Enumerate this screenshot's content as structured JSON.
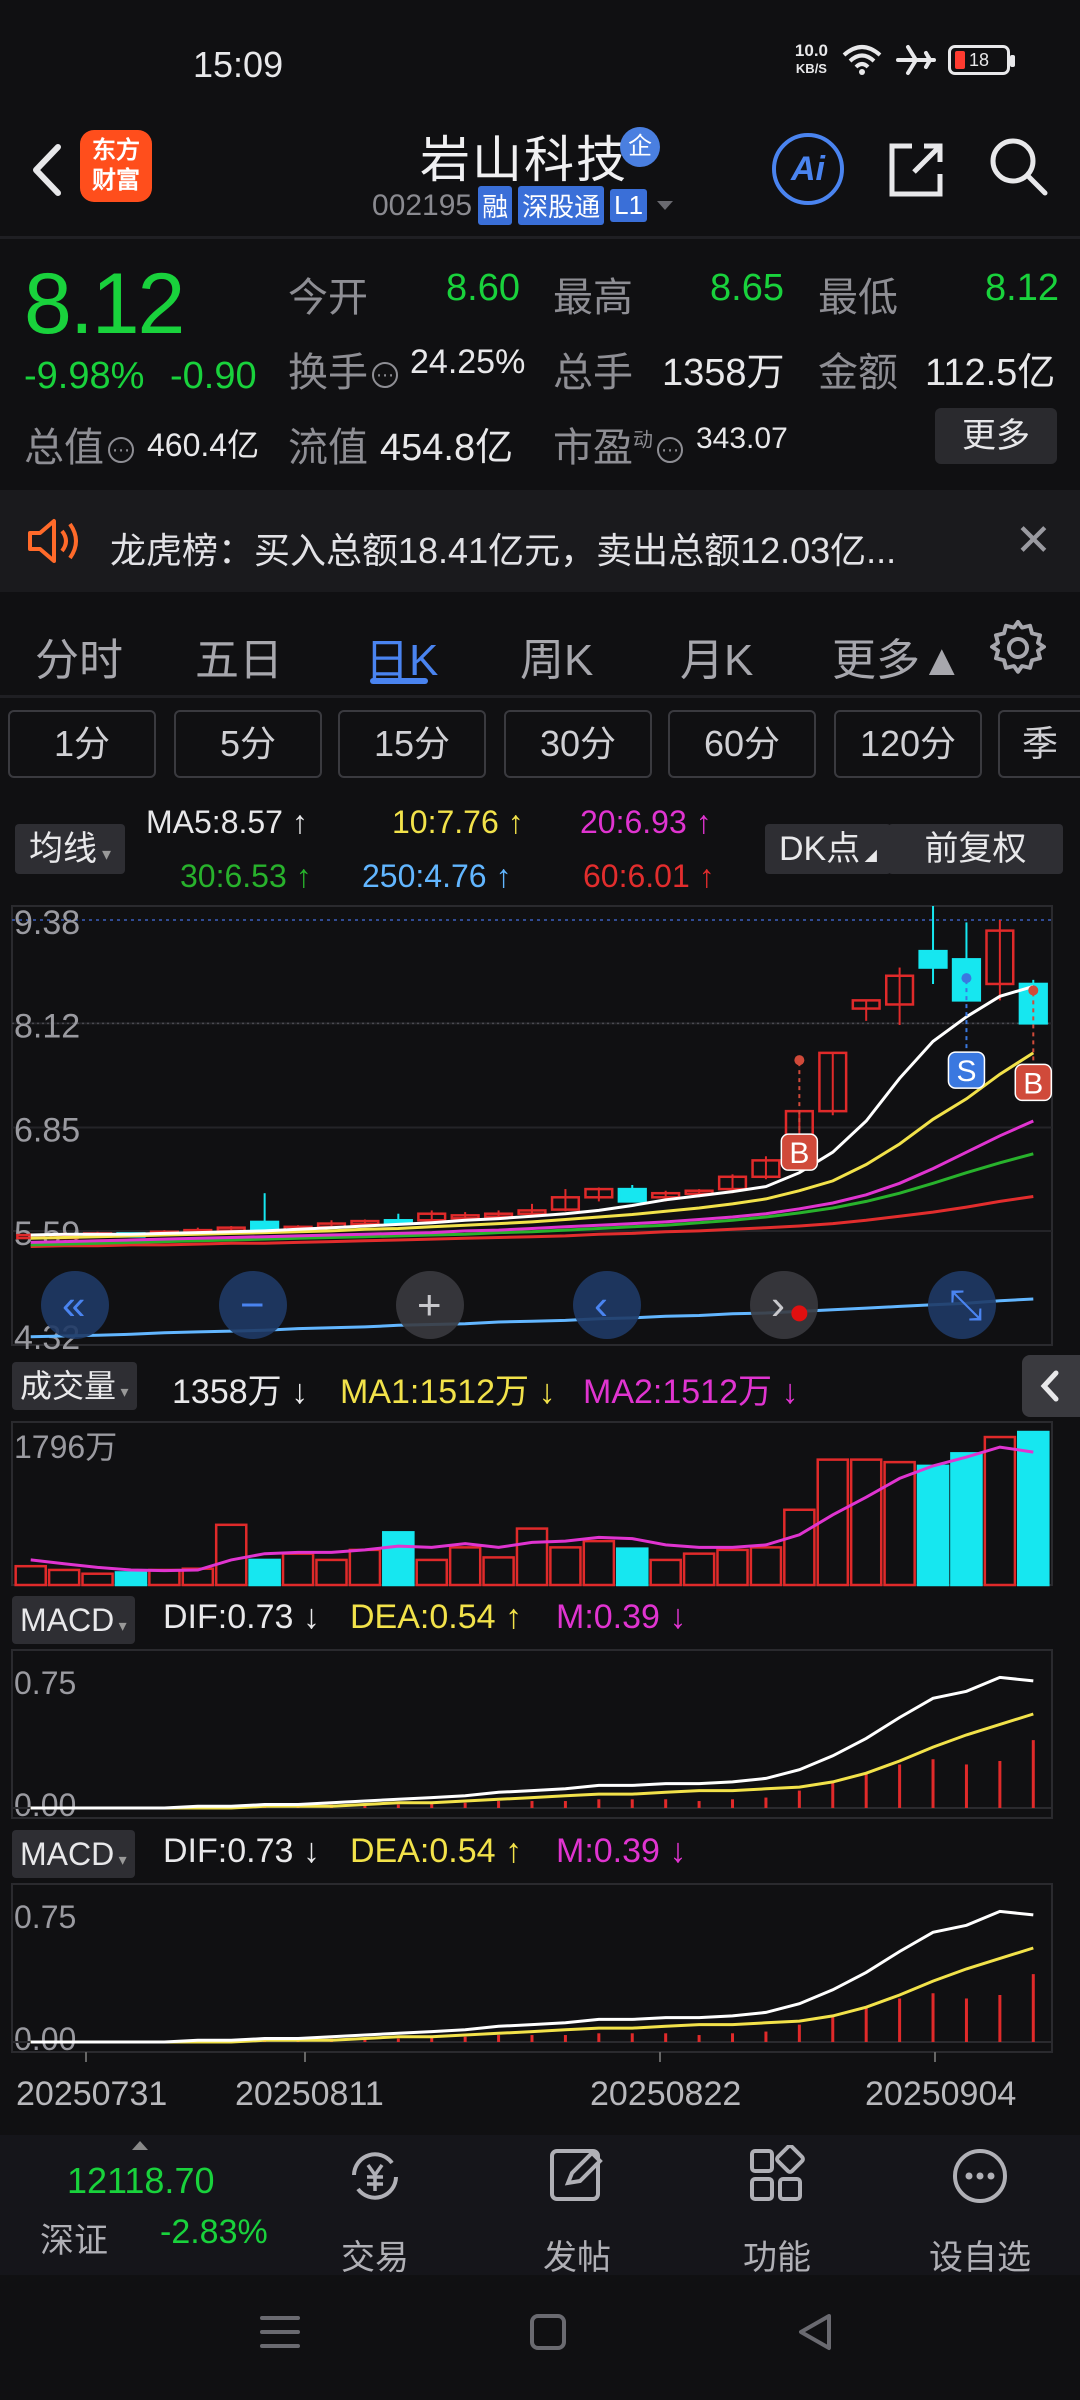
{
  "status": {
    "time": "15:09",
    "net_speed": "10.0",
    "net_unit": "KB/S",
    "battery": "18"
  },
  "header": {
    "logo_line1": "东方",
    "logo_line2": "财富",
    "stock_name": "岩山科技",
    "qi_badge": "企",
    "stock_code": "002195",
    "tags": [
      "融",
      "深股通",
      "L1"
    ],
    "ai_label": "Ai"
  },
  "quote": {
    "price": "8.12",
    "change_pct": "-9.98%",
    "change_amt": "-0.90",
    "open_label": "今开",
    "open": "8.60",
    "high_label": "最高",
    "high": "8.65",
    "low_label": "最低",
    "low": "8.12",
    "turnover_label": "换手",
    "turnover": "24.25%",
    "volume_label": "总手",
    "volume": "1358万",
    "amount_label": "金额",
    "amount": "112.5亿",
    "mcap_label": "总值",
    "mcap": "460.4亿",
    "float_label": "流值",
    "float_mcap": "454.8亿",
    "pe_label": "市盈",
    "pe_sup": "动",
    "pe": "343.07",
    "more_label": "更多"
  },
  "notice": {
    "text": "龙虎榜：买入总额18.41亿元，卖出总额12.03亿..."
  },
  "tabs": [
    "分时",
    "五日",
    "日K",
    "周K",
    "月K",
    "更多▲"
  ],
  "minute_tabs": [
    "1分",
    "5分",
    "15分",
    "30分",
    "60分",
    "120分",
    "季"
  ],
  "ma_legend": {
    "button": "均线",
    "ma5": "MA5:8.57 ↑",
    "ma10": "10:7.76 ↑",
    "ma20": "20:6.93 ↑",
    "ma30": "30:6.53 ↑",
    "ma250": "250:4.76 ↑",
    "ma60": "60:6.01 ↑",
    "dk_button": "DK点",
    "fq_button": "前复权"
  },
  "kline": {
    "y_labels": [
      "9.38",
      "8.12",
      "6.85",
      "5.59",
      "4.32"
    ],
    "ohlc": [
      [
        5.54,
        5.56,
        5.51,
        5.54
      ],
      [
        5.54,
        5.57,
        5.52,
        5.54
      ],
      [
        5.55,
        5.58,
        5.52,
        5.56
      ],
      [
        5.56,
        5.57,
        5.53,
        5.55
      ],
      [
        5.55,
        5.6,
        5.53,
        5.58
      ],
      [
        5.58,
        5.63,
        5.56,
        5.6
      ],
      [
        5.6,
        5.65,
        5.58,
        5.63
      ],
      [
        5.7,
        6.05,
        5.58,
        5.6
      ],
      [
        5.62,
        5.66,
        5.59,
        5.64
      ],
      [
        5.64,
        5.72,
        5.62,
        5.68
      ],
      [
        5.68,
        5.73,
        5.66,
        5.71
      ],
      [
        5.72,
        5.8,
        5.7,
        5.7
      ],
      [
        5.72,
        5.84,
        5.68,
        5.8
      ],
      [
        5.78,
        5.82,
        5.74,
        5.78
      ],
      [
        5.78,
        5.84,
        5.75,
        5.8
      ],
      [
        5.8,
        5.92,
        5.78,
        5.84
      ],
      [
        5.85,
        6.1,
        5.83,
        6.0
      ],
      [
        6.0,
        6.12,
        5.95,
        6.1
      ],
      [
        6.1,
        6.15,
        5.95,
        5.95
      ],
      [
        6.0,
        6.08,
        5.95,
        6.05
      ],
      [
        6.05,
        6.1,
        6.0,
        6.08
      ],
      [
        6.1,
        6.28,
        6.05,
        6.25
      ],
      [
        6.25,
        6.5,
        6.22,
        6.45
      ],
      [
        6.45,
        7.05,
        6.4,
        7.05
      ],
      [
        7.05,
        7.76,
        7.0,
        7.76
      ],
      [
        8.3,
        8.4,
        8.15,
        8.4
      ],
      [
        8.35,
        8.8,
        8.1,
        8.7
      ],
      [
        9.0,
        9.55,
        8.6,
        8.8
      ],
      [
        8.9,
        9.35,
        8.7,
        8.4
      ],
      [
        8.6,
        9.38,
        8.4,
        9.25
      ],
      [
        8.6,
        8.65,
        8.12,
        8.12
      ]
    ],
    "ma5": [
      5.54,
      5.55,
      5.55,
      5.55,
      5.56,
      5.57,
      5.58,
      5.59,
      5.61,
      5.63,
      5.65,
      5.67,
      5.69,
      5.72,
      5.74,
      5.77,
      5.8,
      5.84,
      5.9,
      5.97,
      6.02,
      6.07,
      6.13,
      6.3,
      6.55,
      6.93,
      7.45,
      7.9,
      8.2,
      8.45,
      8.57
    ],
    "ma10": [
      5.5,
      5.51,
      5.52,
      5.53,
      5.54,
      5.55,
      5.56,
      5.57,
      5.58,
      5.59,
      5.61,
      5.62,
      5.64,
      5.66,
      5.68,
      5.7,
      5.73,
      5.76,
      5.79,
      5.83,
      5.87,
      5.92,
      5.98,
      6.08,
      6.2,
      6.4,
      6.65,
      6.95,
      7.2,
      7.5,
      7.76
    ],
    "ma20": [
      5.45,
      5.46,
      5.47,
      5.48,
      5.49,
      5.5,
      5.51,
      5.52,
      5.53,
      5.54,
      5.55,
      5.56,
      5.57,
      5.59,
      5.6,
      5.62,
      5.64,
      5.66,
      5.68,
      5.7,
      5.73,
      5.76,
      5.8,
      5.86,
      5.93,
      6.03,
      6.17,
      6.35,
      6.55,
      6.75,
      6.93
    ],
    "ma30": [
      5.42,
      5.43,
      5.44,
      5.45,
      5.46,
      5.47,
      5.48,
      5.49,
      5.5,
      5.51,
      5.52,
      5.53,
      5.54,
      5.55,
      5.57,
      5.58,
      5.6,
      5.62,
      5.64,
      5.66,
      5.69,
      5.72,
      5.76,
      5.81,
      5.87,
      5.95,
      6.05,
      6.17,
      6.3,
      6.42,
      6.53
    ],
    "ma60": [
      5.4,
      5.41,
      5.41,
      5.42,
      5.42,
      5.43,
      5.44,
      5.44,
      5.45,
      5.46,
      5.47,
      5.48,
      5.49,
      5.5,
      5.51,
      5.52,
      5.53,
      5.55,
      5.56,
      5.58,
      5.59,
      5.61,
      5.63,
      5.65,
      5.68,
      5.72,
      5.77,
      5.82,
      5.88,
      5.95,
      6.01
    ],
    "ma250": [
      4.3,
      4.31,
      4.32,
      4.33,
      4.35,
      4.36,
      4.37,
      4.38,
      4.4,
      4.41,
      4.42,
      4.44,
      4.45,
      4.46,
      4.48,
      4.49,
      4.5,
      4.52,
      4.53,
      4.55,
      4.56,
      4.58,
      4.59,
      4.61,
      4.63,
      4.65,
      4.67,
      4.69,
      4.71,
      4.74,
      4.76
    ],
    "marks": [
      {
        "label": "S",
        "index": 28,
        "price": 7.55,
        "color": "#3a78e0"
      },
      {
        "label": "B",
        "index": 23,
        "price": 6.55,
        "color": "#d04a3a"
      },
      {
        "label": "B",
        "index": 30,
        "price": 7.4,
        "color": "#d04a3a"
      }
    ]
  },
  "controls": [
    "fast-back",
    "zoom-out",
    "zoom-in",
    "prev",
    "next",
    "fullscreen"
  ],
  "volume": {
    "button": "成交量",
    "value": "1358万 ↓",
    "ma1": "MA1:1512万 ↓",
    "ma2": "MA2:1512万 ↓",
    "y_label": "1796万",
    "values": [
      150,
      120,
      90,
      100,
      120,
      130,
      480,
      200,
      250,
      200,
      280,
      420,
      200,
      300,
      220,
      450,
      300,
      350,
      290,
      200,
      250,
      280,
      300,
      600,
      1000,
      1000,
      980,
      950,
      1050,
      1180,
      1220
    ],
    "ma": [
      200,
      170,
      140,
      120,
      115,
      120,
      200,
      250,
      260,
      260,
      280,
      310,
      300,
      330,
      300,
      340,
      350,
      380,
      370,
      320,
      300,
      300,
      320,
      400,
      560,
      700,
      850,
      950,
      1020,
      1100,
      1060
    ]
  },
  "macd1": {
    "button": "MACD",
    "dif": "DIF:0.73 ↓",
    "dea": "DEA:0.54 ↑",
    "m": "M:0.39 ↓",
    "y_top": "0.75",
    "y_bottom": "0.00"
  },
  "macd2": {
    "button": "MACD",
    "dif": "DIF:0.73 ↓",
    "dea": "DEA:0.54 ↑",
    "m": "M:0.39 ↓",
    "y_top": "0.75",
    "y_bottom": "0.00"
  },
  "macd_series": {
    "dif": [
      0.0,
      0.0,
      0.0,
      0.0,
      0.0,
      0.01,
      0.01,
      0.02,
      0.02,
      0.03,
      0.04,
      0.05,
      0.06,
      0.07,
      0.09,
      0.1,
      0.11,
      0.13,
      0.13,
      0.14,
      0.14,
      0.15,
      0.17,
      0.22,
      0.3,
      0.4,
      0.52,
      0.63,
      0.67,
      0.75,
      0.73
    ],
    "dea": [
      0.0,
      0.0,
      0.0,
      0.0,
      0.0,
      0.0,
      0.0,
      0.01,
      0.01,
      0.01,
      0.02,
      0.03,
      0.03,
      0.04,
      0.05,
      0.06,
      0.07,
      0.08,
      0.08,
      0.09,
      0.1,
      0.1,
      0.11,
      0.12,
      0.15,
      0.2,
      0.27,
      0.35,
      0.42,
      0.48,
      0.54
    ],
    "m": [
      0.0,
      0.0,
      0.0,
      0.0,
      0.0,
      0.01,
      0.01,
      0.01,
      0.01,
      0.02,
      0.02,
      0.02,
      0.03,
      0.03,
      0.04,
      0.04,
      0.04,
      0.05,
      0.05,
      0.05,
      0.04,
      0.05,
      0.06,
      0.1,
      0.15,
      0.2,
      0.25,
      0.28,
      0.25,
      0.27,
      0.39
    ]
  },
  "dates": [
    "20250731",
    "20250811",
    "20250822",
    "20250904"
  ],
  "bottom": {
    "index_value": "12118.70",
    "index_name": "深证",
    "index_change": "-2.83%",
    "items": [
      "交易",
      "发帖",
      "功能",
      "设自选"
    ]
  }
}
